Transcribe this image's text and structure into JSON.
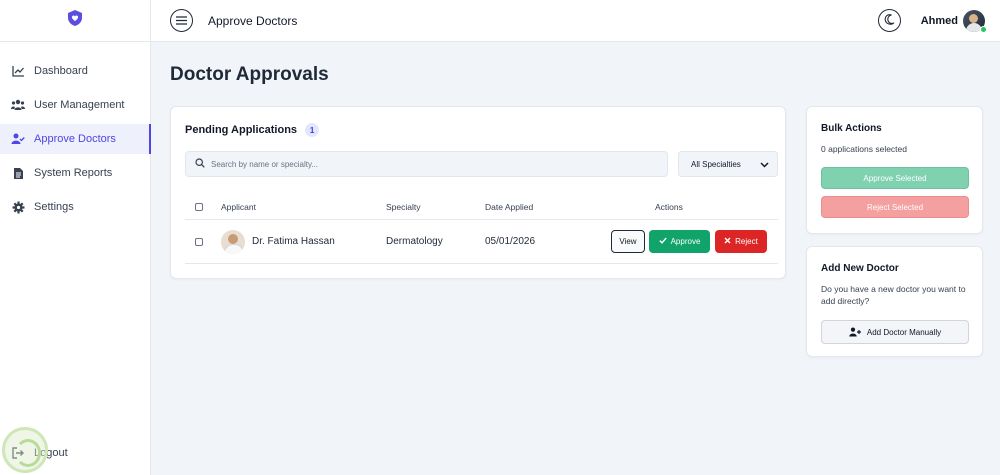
{
  "header": {
    "title": "Approve Doctors",
    "username": "Ahmed"
  },
  "sidebar": {
    "items": [
      {
        "label": "Dashboard",
        "icon": "chart-line-icon"
      },
      {
        "label": "User Management",
        "icon": "users-icon"
      },
      {
        "label": "Approve Doctors",
        "icon": "user-check-icon"
      },
      {
        "label": "System Reports",
        "icon": "file-icon"
      },
      {
        "label": "Settings",
        "icon": "gear-icon"
      }
    ],
    "active_index": 2,
    "logout_label": "Logout"
  },
  "main": {
    "page_title": "Doctor Approvals",
    "pending": {
      "title": "Pending Applications",
      "count": "1",
      "search_placeholder": "Search by name or specialty...",
      "filter_value": "All Specialties",
      "columns": {
        "applicant": "Applicant",
        "specialty": "Specialty",
        "date": "Date Applied",
        "actions": "Actions"
      },
      "rows": [
        {
          "name": "Dr. Fatima Hassan",
          "specialty": "Dermatology",
          "date": "05/01/2026",
          "view_label": "View",
          "approve_label": "Approve",
          "reject_label": "Reject"
        }
      ]
    }
  },
  "bulk": {
    "title": "Bulk Actions",
    "selected_text": "0 applications selected",
    "approve_label": "Approve Selected",
    "reject_label": "Reject Selected"
  },
  "add_doctor": {
    "title": "Add New Doctor",
    "description": "Do you have a new doctor you want to add directly?",
    "button_label": "Add Doctor Manually"
  },
  "colors": {
    "accent": "#4f46e5",
    "approve": "#10a36a",
    "reject": "#dc2626"
  }
}
